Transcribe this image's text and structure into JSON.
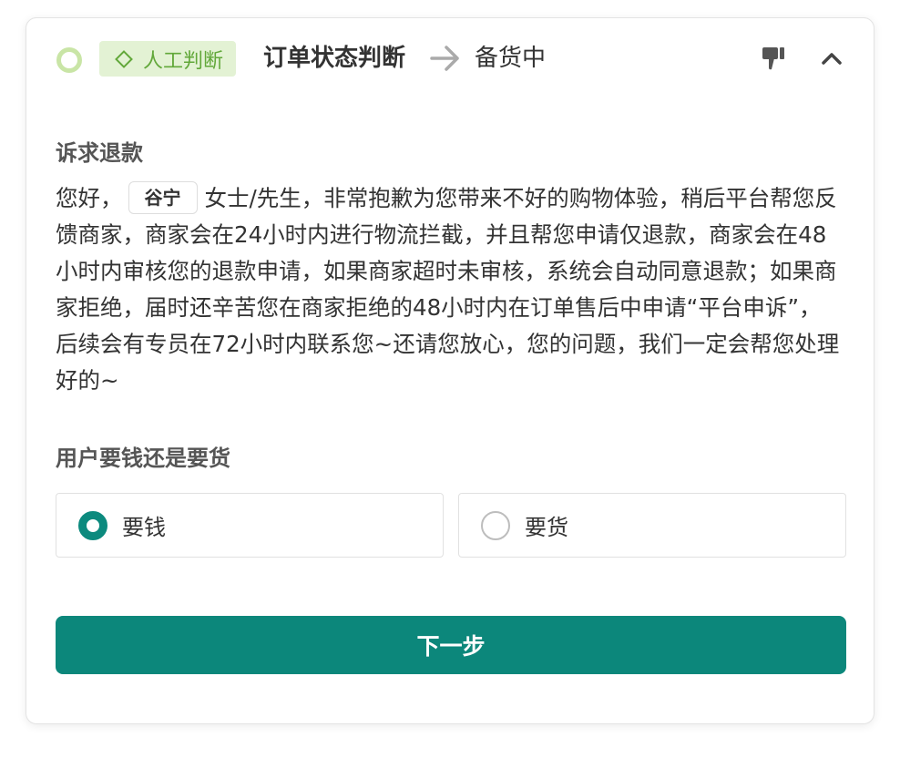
{
  "header": {
    "tag_label": "人工判断",
    "title": "订单状态判断",
    "state": "备货中",
    "icons": [
      "status-ring-icon",
      "diamond-icon",
      "arrow-right-icon",
      "thumbs-down-icon",
      "chevron-up-icon"
    ],
    "accent_green": "#62a83a",
    "tag_bg": "#e3f2d4"
  },
  "complaint": {
    "label": "诉求退款",
    "reply_prefix": "您好，",
    "customer_name": "谷宁",
    "reply_body": "女士/先生，非常抱歉为您带来不好的购物体验，稍后平台帮您反馈商家，商家会在24小时内进行物流拦截，并且帮您申请仅退款，商家会在48小时内审核您的退款申请，如果商家超时未审核，系统会自动同意退款；如果商家拒绝，届时还辛苦您在商家拒绝的48小时内在订单售后中申请“平台申诉”，后续会有专员在72小时内联系您~还请您放心，您的问题，我们一定会帮您处理好的~"
  },
  "question": {
    "label": "用户要钱还是要货",
    "options": [
      {
        "label": "要钱",
        "selected": true
      },
      {
        "label": "要货",
        "selected": false
      }
    ]
  },
  "actions": {
    "next_label": "下一步",
    "primary_color": "#0c877b"
  }
}
